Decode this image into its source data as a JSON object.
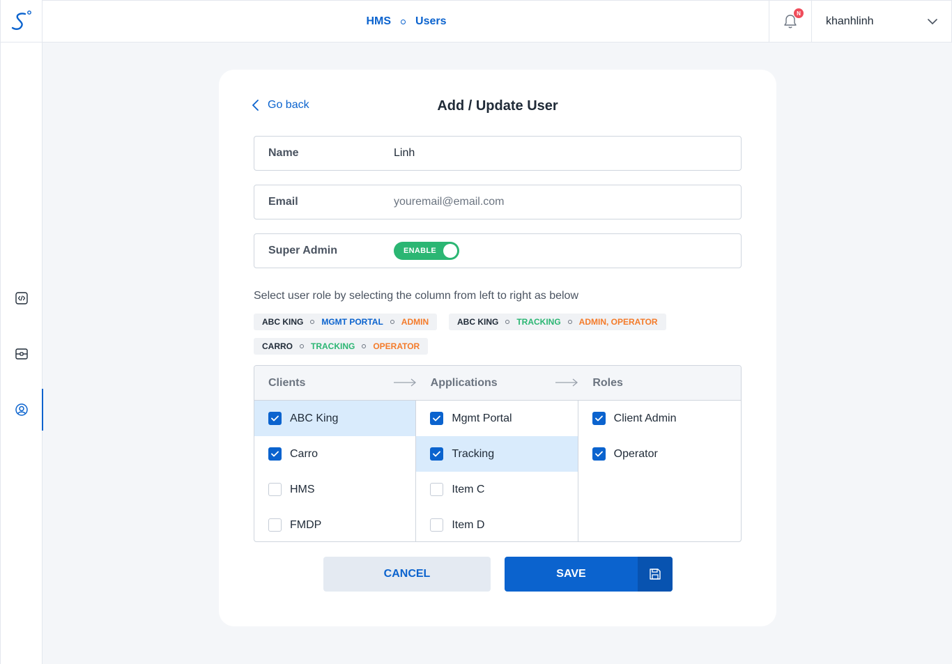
{
  "header": {
    "breadcrumb": [
      "HMS",
      "Users"
    ],
    "notification_badge": "N",
    "username": "khanhlinh"
  },
  "sidebar": {
    "items": [
      {
        "icon": "code-icon"
      },
      {
        "icon": "server-icon"
      },
      {
        "icon": "user-circle-icon",
        "active": true
      }
    ]
  },
  "form": {
    "go_back": "Go back",
    "title": "Add / Update User",
    "name_label": "Name",
    "name_value": "Linh",
    "email_label": "Email",
    "email_placeholder": "youremail@email.com",
    "super_admin_label": "Super Admin",
    "toggle_label": "ENABLE",
    "hint": "Select user role by selecting the column from left to right as below"
  },
  "chips": [
    [
      "ABC KING",
      "MGMT PORTAL",
      "ADMIN"
    ],
    [
      "ABC KING",
      "TRACKING",
      "ADMIN, OPERATOR"
    ],
    [
      "CARRO",
      "TRACKING",
      "OPERATOR"
    ]
  ],
  "selector": {
    "headers": [
      "Clients",
      "Applications",
      "Roles"
    ],
    "clients": [
      {
        "label": "ABC King",
        "checked": true,
        "highlight": true
      },
      {
        "label": "Carro",
        "checked": true,
        "highlight": false
      },
      {
        "label": "HMS",
        "checked": false,
        "highlight": false
      },
      {
        "label": "FMDP",
        "checked": false,
        "highlight": false
      }
    ],
    "applications": [
      {
        "label": "Mgmt Portal",
        "checked": true,
        "highlight": false
      },
      {
        "label": "Tracking",
        "checked": true,
        "highlight": true
      },
      {
        "label": "Item C",
        "checked": false,
        "highlight": false
      },
      {
        "label": "Item D",
        "checked": false,
        "highlight": false
      }
    ],
    "roles": [
      {
        "label": "Client Admin",
        "checked": true,
        "highlight": false
      },
      {
        "label": "Operator",
        "checked": true,
        "highlight": false
      }
    ]
  },
  "buttons": {
    "cancel": "CANCEL",
    "save": "SAVE"
  },
  "colors": {
    "primary": "#0b63ce",
    "success": "#2bb673",
    "warning": "#f47b2a",
    "highlight": "#d9ebfc"
  }
}
